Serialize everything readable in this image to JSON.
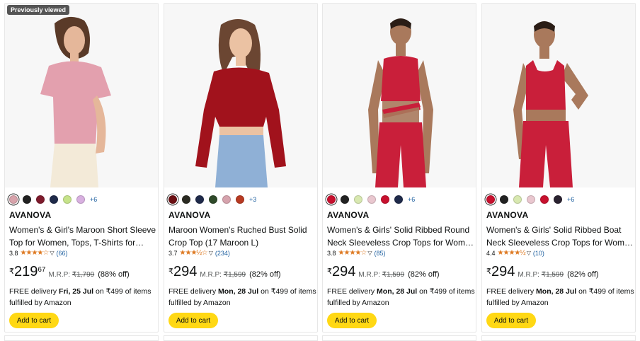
{
  "products": [
    {
      "badge": "Previously viewed",
      "swatches": [
        "#d8a3ab",
        "#222222",
        "#7e1a2c",
        "#1f2a4a",
        "#c6e38a",
        "#d8b0e0"
      ],
      "swatch_more": "+6",
      "brand": "AVANOVA",
      "title1": "Women's & Girl's Maroon Short Sleeve",
      "title2": "Top for Women, Tops, T-Shirts for…",
      "rating": "3.8",
      "stars": "★★★★☆",
      "reviews": "(66)",
      "currency": "₹",
      "price_whole": "219",
      "price_fraction": "67",
      "mrp_label": "M.R.P:",
      "mrp": "₹1,799",
      "discount": "(88% off)",
      "delivery_prefix": "FREE delivery ",
      "delivery_date": "Fri, 25 Jul",
      "delivery_suffix": " on ₹499 of items",
      "fulfilled": "fulfilled by Amazon",
      "cart_label": "Add to cart",
      "garment_color": "#e3a0ae",
      "bottom_color": "#f3ead8"
    },
    {
      "badge": "",
      "swatches": [
        "#6b0f12",
        "#2b2b22",
        "#1f2a4a",
        "#2f4a2a",
        "#d6a3ad",
        "#b83a22"
      ],
      "swatch_more": "+3",
      "brand": "AVANOVA",
      "title1": "Maroon Women's Ruched Bust Solid",
      "title2": "Crop Top (17 Maroon L)",
      "rating": "3.7",
      "stars": "★★★½☆",
      "reviews": "(234)",
      "currency": "₹",
      "price_whole": "294",
      "price_fraction": "",
      "mrp_label": "M.R.P:",
      "mrp": "₹1,599",
      "discount": "(82% off)",
      "delivery_prefix": "FREE delivery ",
      "delivery_date": "Mon, 28 Jul",
      "delivery_suffix": " on ₹499 of items",
      "fulfilled": "fulfilled by Amazon",
      "cart_label": "Add to cart",
      "garment_color": "#a1121c",
      "bottom_color": "#8fb0d6"
    },
    {
      "badge": "",
      "swatches": [
        "#c8102e",
        "#222222",
        "#d8e8b0",
        "#e9c7cf",
        "#c8102e",
        "#1f2a4a"
      ],
      "swatch_more": "+6",
      "brand": "AVANOVA",
      "title1": "Women's & Girls' Solid Ribbed Round",
      "title2": "Neck Sleeveless Crop Tops for Women",
      "rating": "3.8",
      "stars": "★★★★☆",
      "reviews": "(85)",
      "currency": "₹",
      "price_whole": "294",
      "price_fraction": "",
      "mrp_label": "M.R.P:",
      "mrp": "₹1,599",
      "discount": "(82% off)",
      "delivery_prefix": "FREE delivery ",
      "delivery_date": "Mon, 28 Jul",
      "delivery_suffix": " on ₹499 of items",
      "fulfilled": "fulfilled by Amazon",
      "cart_label": "Add to cart",
      "garment_color": "#c91f3a",
      "bottom_color": "#c91f3a"
    },
    {
      "badge": "",
      "swatches": [
        "#c8102e",
        "#222222",
        "#d8e8b0",
        "#e9c7cf",
        "#c8102e",
        "#2a2230"
      ],
      "swatch_more": "+6",
      "brand": "AVANOVA",
      "title1": "Women's & Girls' Solid Ribbed Boat",
      "title2": "Neck Sleeveless Crop Tops for Women",
      "rating": "4.4",
      "stars": "★★★★½",
      "reviews": "(10)",
      "currency": "₹",
      "price_whole": "294",
      "price_fraction": "",
      "mrp_label": "M.R.P:",
      "mrp": "₹1,599",
      "discount": "(82% off)",
      "delivery_prefix": "FREE delivery ",
      "delivery_date": "Mon, 28 Jul",
      "delivery_suffix": " on ₹499 of items",
      "fulfilled": "fulfilled by Amazon",
      "cart_label": "Add to cart",
      "garment_color": "#c91f3a",
      "bottom_color": "#c91f3a"
    }
  ]
}
